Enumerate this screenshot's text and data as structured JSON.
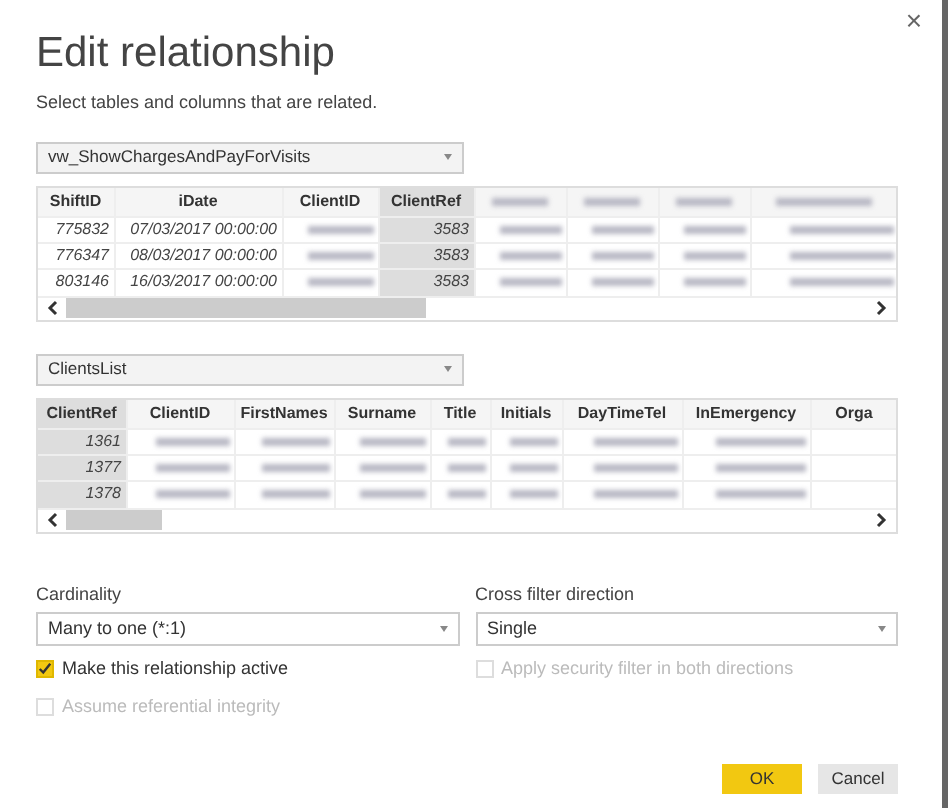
{
  "dialog": {
    "title": "Edit relationship",
    "subtitle": "Select tables and columns that are related.",
    "close": "×"
  },
  "tables": [
    {
      "source": "vw_ShowChargesAndPayForVisits",
      "columns": [
        {
          "label": "ShiftID",
          "selected": false
        },
        {
          "label": "iDate",
          "selected": false
        },
        {
          "label": "ClientID",
          "selected": false
        },
        {
          "label": "ClientRef",
          "selected": true
        },
        {
          "kind": "blurred",
          "selected": false
        },
        {
          "kind": "blurred",
          "selected": false
        },
        {
          "kind": "blurred",
          "selected": false
        },
        {
          "kind": "blurred",
          "selected": false
        }
      ],
      "rows": [
        [
          "775832",
          "07/03/2017 00:00:00",
          {
            "kind": "blurred"
          },
          "3583",
          {
            "kind": "blurred"
          },
          {
            "kind": "blurred"
          },
          {
            "kind": "blurred"
          },
          {
            "kind": "blurred"
          }
        ],
        [
          "776347",
          "08/03/2017 00:00:00",
          {
            "kind": "blurred"
          },
          "3583",
          {
            "kind": "blurred"
          },
          {
            "kind": "blurred"
          },
          {
            "kind": "blurred"
          },
          {
            "kind": "blurred"
          }
        ],
        [
          "803146",
          "16/03/2017 00:00:00",
          {
            "kind": "blurred"
          },
          "3583",
          {
            "kind": "blurred"
          },
          {
            "kind": "blurred"
          },
          {
            "kind": "blurred"
          },
          {
            "kind": "blurred"
          }
        ]
      ]
    },
    {
      "source": "ClientsList",
      "columns": [
        {
          "label": "ClientRef",
          "selected": true
        },
        {
          "label": "ClientID",
          "selected": false
        },
        {
          "label": "FirstNames",
          "selected": false
        },
        {
          "label": "Surname",
          "selected": false
        },
        {
          "label": "Title",
          "selected": false
        },
        {
          "label": "Initials",
          "selected": false
        },
        {
          "label": "DayTimeTel",
          "selected": false
        },
        {
          "label": "InEmergency",
          "selected": false
        },
        {
          "label": "Orga",
          "selected": false
        }
      ],
      "rows": [
        [
          "1361",
          {
            "kind": "blurred"
          },
          {
            "kind": "blurred"
          },
          {
            "kind": "blurred"
          },
          {
            "kind": "blurred"
          },
          {
            "kind": "blurred"
          },
          {
            "kind": "blurred"
          },
          {
            "kind": "blurred"
          },
          {
            "kind": "empty"
          }
        ],
        [
          "1377",
          {
            "kind": "blurred"
          },
          {
            "kind": "blurred"
          },
          {
            "kind": "blurred"
          },
          {
            "kind": "blurred"
          },
          {
            "kind": "blurred"
          },
          {
            "kind": "blurred"
          },
          {
            "kind": "blurred"
          },
          {
            "kind": "empty"
          }
        ],
        [
          "1378",
          {
            "kind": "blurred"
          },
          {
            "kind": "blurred"
          },
          {
            "kind": "blurred"
          },
          {
            "kind": "blurred"
          },
          {
            "kind": "blurred"
          },
          {
            "kind": "blurred"
          },
          {
            "kind": "blurred"
          },
          {
            "kind": "empty"
          }
        ]
      ]
    }
  ],
  "options": [
    {
      "label": "Cardinality",
      "value": "Many to one (*:1)"
    },
    {
      "label": "Cross filter direction",
      "value": "Single"
    }
  ],
  "checkboxes": [
    [
      {
        "label": "Make this relationship active",
        "checked": true,
        "disabled": false
      },
      {
        "label": "Assume referential integrity",
        "checked": false,
        "disabled": true
      }
    ],
    [
      {
        "label": "Apply security filter in both directions",
        "checked": false,
        "disabled": true
      }
    ]
  ],
  "buttons": [
    {
      "label": "OK",
      "kind": "primary"
    },
    {
      "label": "Cancel",
      "kind": "secondary"
    }
  ]
}
